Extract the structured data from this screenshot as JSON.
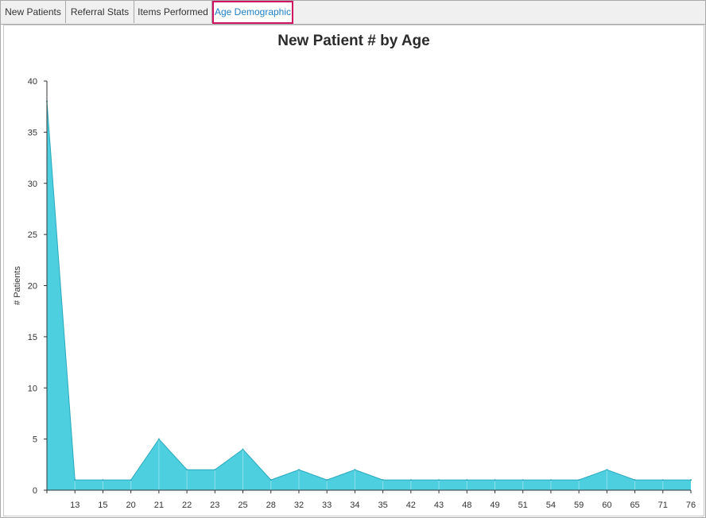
{
  "tabs": [
    {
      "label": "New Patients",
      "active": false
    },
    {
      "label": "Referral Stats",
      "active": false
    },
    {
      "label": "Items Performed",
      "active": false
    },
    {
      "label": "Age Demographic",
      "active": true
    }
  ],
  "colors": {
    "area_fill": "#4ecfe0",
    "area_line": "#2aa9bd",
    "active_tab_border": "#d11562",
    "active_tab_text": "#1f7fc4"
  },
  "chart_data": {
    "type": "area",
    "title": "New Patient # by Age",
    "xlabel": "",
    "ylabel": "# Patients",
    "ylim": [
      0,
      40
    ],
    "yticks": [
      0,
      5,
      10,
      15,
      20,
      25,
      30,
      35,
      40
    ],
    "categories": [
      "",
      "13",
      "15",
      "20",
      "21",
      "22",
      "23",
      "25",
      "28",
      "32",
      "33",
      "34",
      "35",
      "42",
      "43",
      "48",
      "49",
      "51",
      "54",
      "59",
      "60",
      "65",
      "71",
      "76"
    ],
    "values": [
      38,
      1,
      1,
      1,
      5,
      2,
      2,
      4,
      1,
      2,
      1,
      2,
      1,
      1,
      1,
      1,
      1,
      1,
      1,
      1,
      2,
      1,
      1,
      1
    ],
    "grid": false,
    "legend": "none"
  }
}
